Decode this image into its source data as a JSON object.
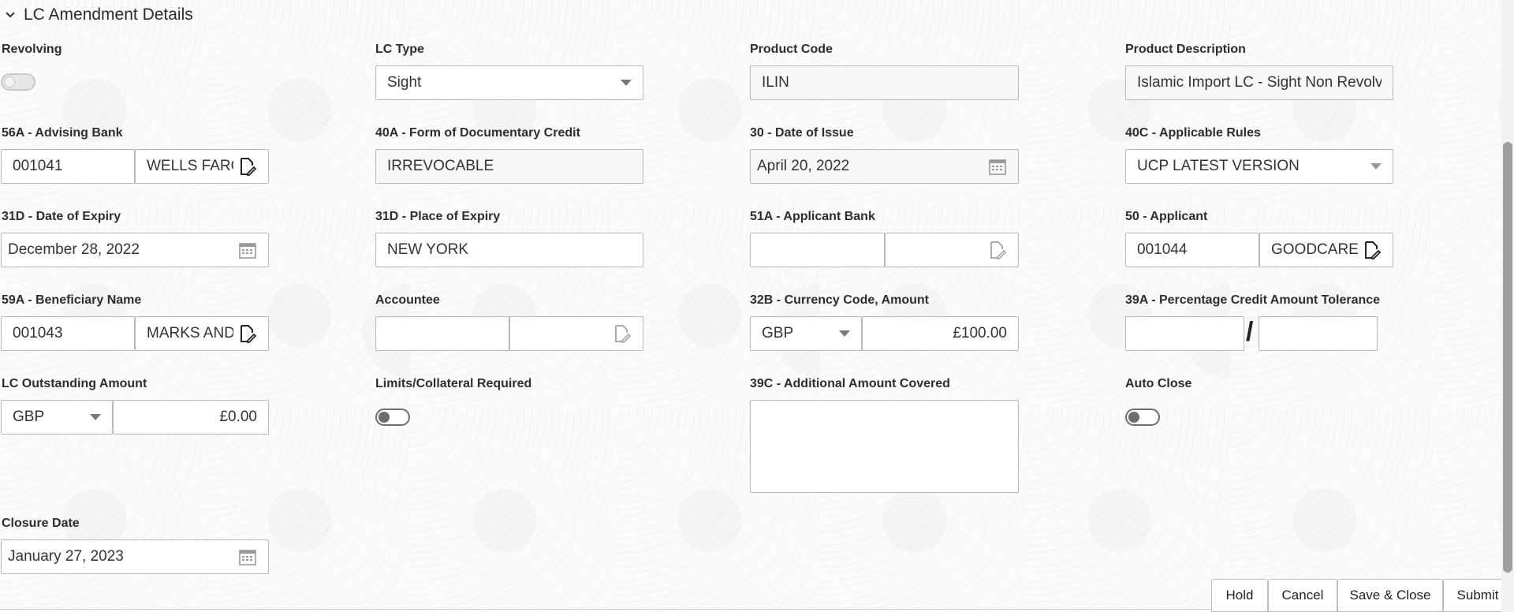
{
  "section": {
    "title": "LC Amendment Details"
  },
  "fields": {
    "revolving": {
      "label": "Revolving"
    },
    "lc_type": {
      "label": "LC Type",
      "value": "Sight"
    },
    "product_code": {
      "label": "Product Code",
      "value": "ILIN"
    },
    "product_description": {
      "label": "Product Description",
      "value": "Islamic Import LC - Sight Non Revolving"
    },
    "advising_bank": {
      "label": "56A - Advising Bank",
      "code": "001041",
      "name": "WELLS FARGO"
    },
    "form_of_credit": {
      "label": "40A - Form of Documentary Credit",
      "value": "IRREVOCABLE"
    },
    "date_of_issue": {
      "label": "30 - Date of Issue",
      "value": "April 20, 2022"
    },
    "applicable_rules": {
      "label": "40C - Applicable Rules",
      "value": "UCP LATEST VERSION"
    },
    "date_of_expiry": {
      "label": "31D - Date of Expiry",
      "value": "December 28, 2022"
    },
    "place_of_expiry": {
      "label": "31D - Place of Expiry",
      "value": "NEW YORK"
    },
    "applicant_bank": {
      "label": "51A - Applicant Bank",
      "code": "",
      "name": ""
    },
    "applicant": {
      "label": "50 - Applicant",
      "code": "001044",
      "name": "GOODCARE"
    },
    "beneficiary": {
      "label": "59A - Beneficiary Name",
      "code": "001043",
      "name": "MARKS AND"
    },
    "accountee": {
      "label": "Accountee",
      "code": "",
      "name": ""
    },
    "currency_amount": {
      "label": "32B - Currency Code, Amount",
      "currency": "GBP",
      "amount": "£100.00"
    },
    "tolerance": {
      "label": "39A - Percentage Credit Amount Tolerance",
      "plus": "",
      "minus": "",
      "separator": "/"
    },
    "outstanding": {
      "label": "LC Outstanding Amount",
      "currency": "GBP",
      "amount": "£0.00"
    },
    "limits_required": {
      "label": "Limits/Collateral Required"
    },
    "additional_amount": {
      "label": "39C - Additional Amount Covered",
      "value": ""
    },
    "auto_close": {
      "label": "Auto Close"
    },
    "closure_date": {
      "label": "Closure Date",
      "value": "January 27, 2023"
    }
  },
  "actions": {
    "hold": "Hold",
    "cancel": "Cancel",
    "save_close": "Save & Close",
    "submit": "Submit"
  }
}
